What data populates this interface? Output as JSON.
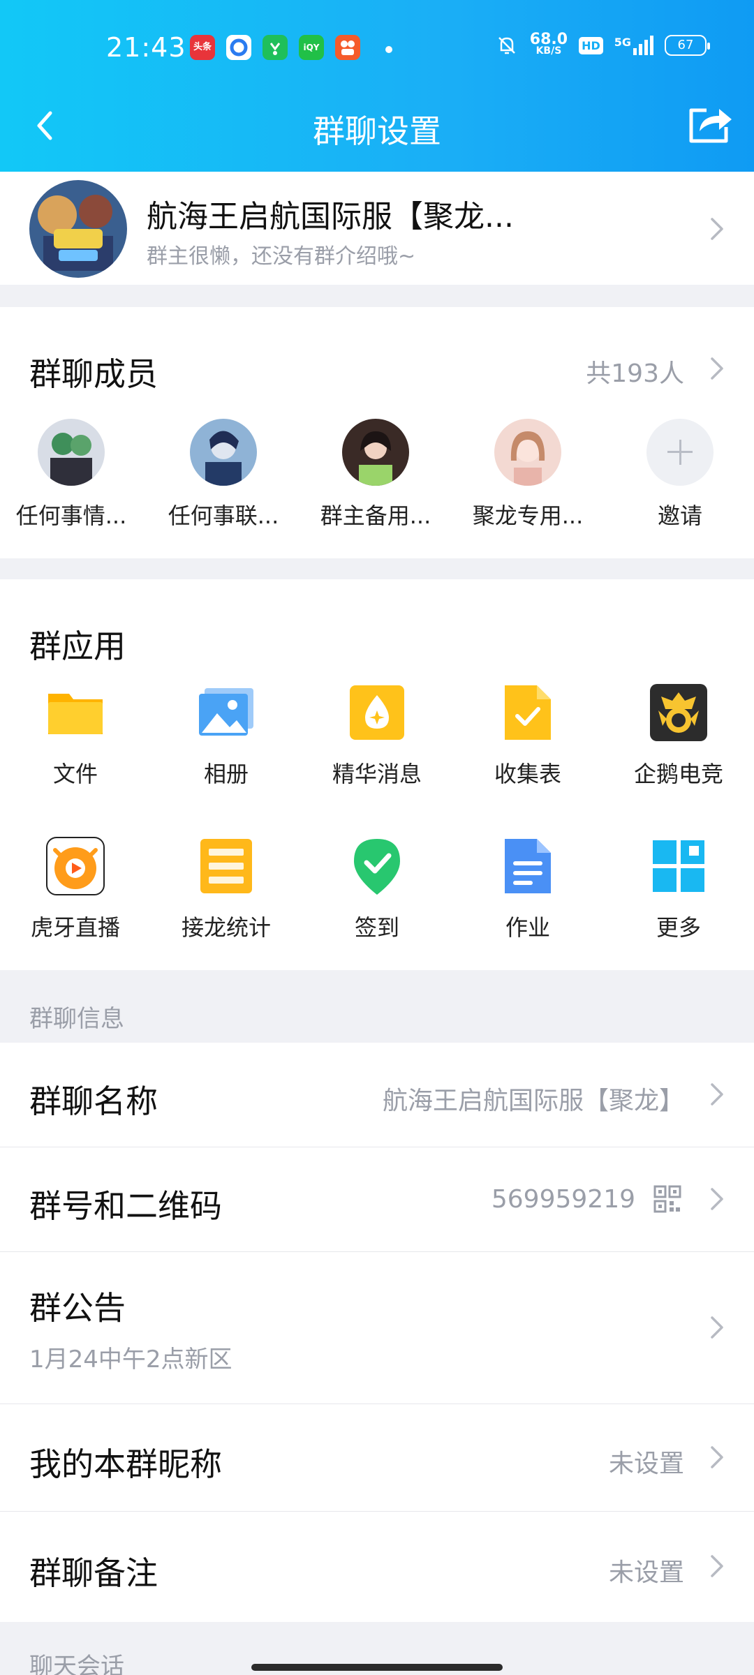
{
  "status_bar": {
    "time": "21:43",
    "app_icons": [
      {
        "name": "toutiao-icon",
        "text": "头条",
        "color": "#e8343a"
      },
      {
        "name": "browser-icon",
        "text": "",
        "color": "#ffffff"
      },
      {
        "name": "app-green-icon",
        "text": "",
        "color": "#1fbf5b"
      },
      {
        "name": "iqiyi-icon",
        "text": "iQY",
        "color": "#21c047"
      },
      {
        "name": "app-orange-icon",
        "text": "",
        "color": "#f55b2a"
      }
    ],
    "net_speed": "68.0",
    "net_unit": "KB/S",
    "hd": "HD",
    "signal": "5G",
    "battery": "67"
  },
  "navbar": {
    "title": "群聊设置"
  },
  "group": {
    "name": "航海王启航国际服【聚龙...",
    "intro": "群主很懒，还没有群介绍哦~"
  },
  "members": {
    "title": "群聊成员",
    "count": "共193人",
    "list": [
      {
        "name": "任何事情..."
      },
      {
        "name": "任何事联..."
      },
      {
        "name": "群主备用..."
      },
      {
        "name": "聚龙专用..."
      }
    ],
    "invite": "邀请"
  },
  "apps": {
    "title": "群应用",
    "items": [
      {
        "label": "文件",
        "icon": "folder-icon",
        "color": "#ffc21a"
      },
      {
        "label": "相册",
        "icon": "album-icon",
        "color": "#4aa3f5"
      },
      {
        "label": "精华消息",
        "icon": "essence-icon",
        "color": "#ffc21a"
      },
      {
        "label": "收集表",
        "icon": "collect-form-icon",
        "color": "#ffc21a"
      },
      {
        "label": "企鹅电竞",
        "icon": "esports-icon",
        "color": "#2c2c2c"
      },
      {
        "label": "虎牙直播",
        "icon": "huya-icon",
        "color": "#ff9c1a"
      },
      {
        "label": "接龙统计",
        "icon": "relay-stats-icon",
        "color": "#ffb81a"
      },
      {
        "label": "签到",
        "icon": "checkin-icon",
        "color": "#28c76f"
      },
      {
        "label": "作业",
        "icon": "homework-icon",
        "color": "#4a90f5"
      },
      {
        "label": "更多",
        "icon": "more-grid-icon",
        "color": "#19b8f2"
      }
    ]
  },
  "group_info": {
    "section_label": "群聊信息",
    "rows": {
      "name": {
        "label": "群聊名称",
        "value": "航海王启航国际服【聚龙】"
      },
      "number": {
        "label": "群号和二维码",
        "value": "569959219"
      },
      "notice": {
        "label": "群公告",
        "value": "1月24中午2点新区"
      },
      "nickname": {
        "label": "我的本群昵称",
        "value": "未设置"
      },
      "remark": {
        "label": "群聊备注",
        "value": "未设置"
      }
    }
  },
  "chat_section_label": "聊天会话"
}
